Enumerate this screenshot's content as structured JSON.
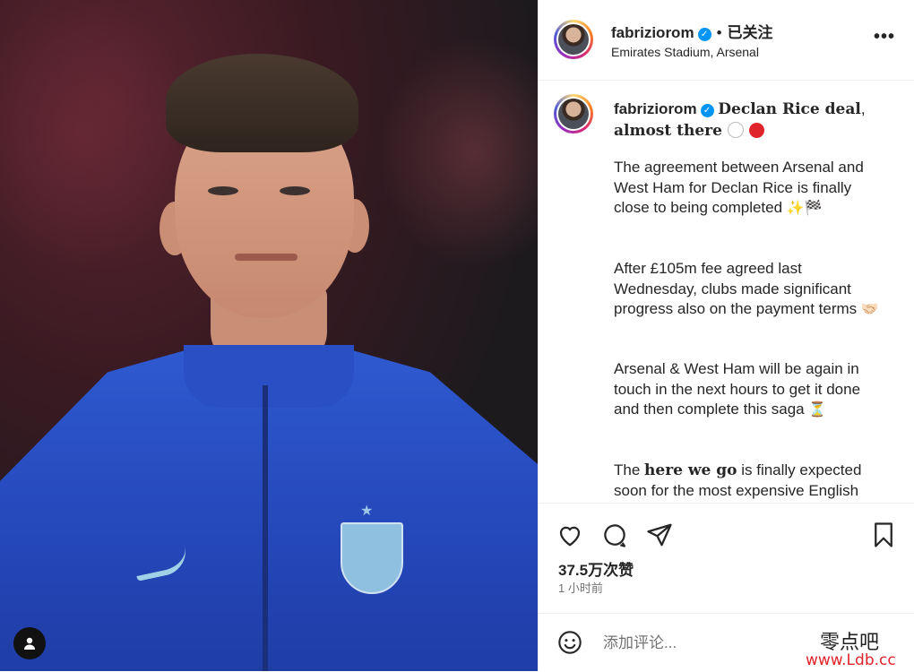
{
  "header": {
    "username": "fabriziorom",
    "separator": "•",
    "follow_status": "已关注",
    "location": "Emirates Stadium, Arsenal",
    "more_icon": "more-horizontal-icon"
  },
  "caption": {
    "username": "fabriziorom",
    "title_part1": "Declan Rice deal",
    "title_comma": ",",
    "title_part2": "almost there",
    "p1": "The agreement between Arsenal and West Ham for Declan Rice is finally close to being completed",
    "p1_emoji": "✨🏁",
    "p2": "After £105m fee agreed last Wednesday, clubs made significant progress also on the payment terms",
    "p2_emoji": "🤝🏻",
    "p3": "Arsenal & West Ham will be again in touch in the next hours to get it done and then complete this saga",
    "p3_emoji": "⏳",
    "p4_pre": "The ",
    "p4_bold": "here we go",
    "p4_post": " is finally expected soon for the most expensive English"
  },
  "actions": {
    "likes": "37.5万次赞",
    "time": "1 小时前"
  },
  "comment": {
    "placeholder": "添加评论..."
  },
  "watermark": {
    "line1": "零点吧",
    "line2": "www.Ldb.cc"
  },
  "colors": {
    "verified": "#0095f6",
    "jacket": "#2446b8",
    "red_circle": "#e0242b"
  }
}
